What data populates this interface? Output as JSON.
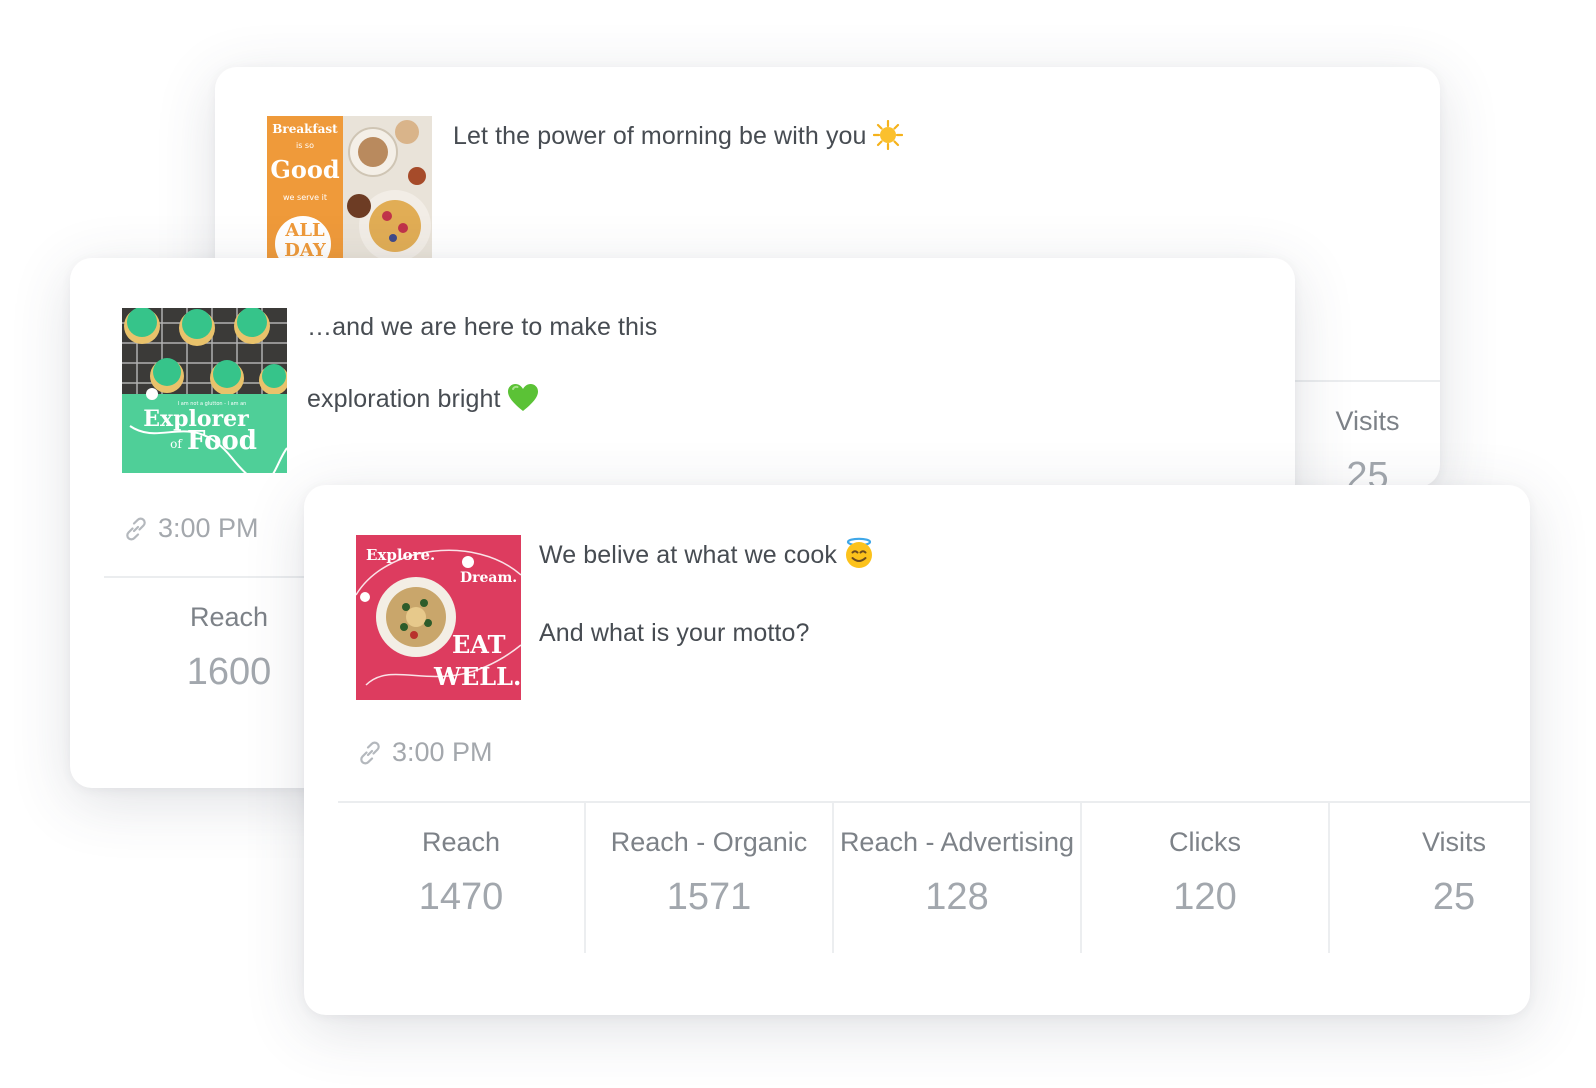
{
  "posts": [
    {
      "id": "breakfast",
      "image_text": {
        "line1": "Breakfast",
        "line2": "is so",
        "line3": "Good",
        "line4": "we serve it",
        "line5": "ALL",
        "line6": "DAY"
      },
      "text_lines": [
        "Let the power of morning be with you"
      ],
      "emoji": "sun-emoji",
      "metrics": [
        {
          "label": "Visits",
          "value": "25"
        }
      ]
    },
    {
      "id": "explorer",
      "image_text": {
        "small": "I am not a glutton - I am an",
        "line1": "Explorer",
        "line2": "of",
        "line3": "Food"
      },
      "text_lines": [
        "…and we are here to make this",
        "exploration bright"
      ],
      "emoji": "green-heart-emoji",
      "time": "3:00 PM",
      "metrics": [
        {
          "label": "Reach",
          "value": "1600"
        }
      ]
    },
    {
      "id": "eatwell",
      "image_text": {
        "line1": "Explore.",
        "line2": "Dream.",
        "line3": "EAT",
        "line4": "WELL."
      },
      "text_lines": [
        "We belive at what we cook",
        "And what is your motto?"
      ],
      "emoji": "smiling-halo-emoji",
      "time": "3:00 PM",
      "metrics": [
        {
          "label": "Reach",
          "value": "1470"
        },
        {
          "label": "Reach - Organic",
          "value": "1571"
        },
        {
          "label": "Reach - Advertising",
          "value": "128"
        },
        {
          "label": "Clicks",
          "value": "120"
        },
        {
          "label": "Visits",
          "value": "25"
        }
      ]
    }
  ],
  "colors": {
    "breakfast_orange": "#ef9a3a",
    "explorer_green": "#4fcf98",
    "eatwell_pink": "#dd3c5f",
    "metric_value": "#a2a7ad",
    "metric_label": "#7d8288"
  }
}
